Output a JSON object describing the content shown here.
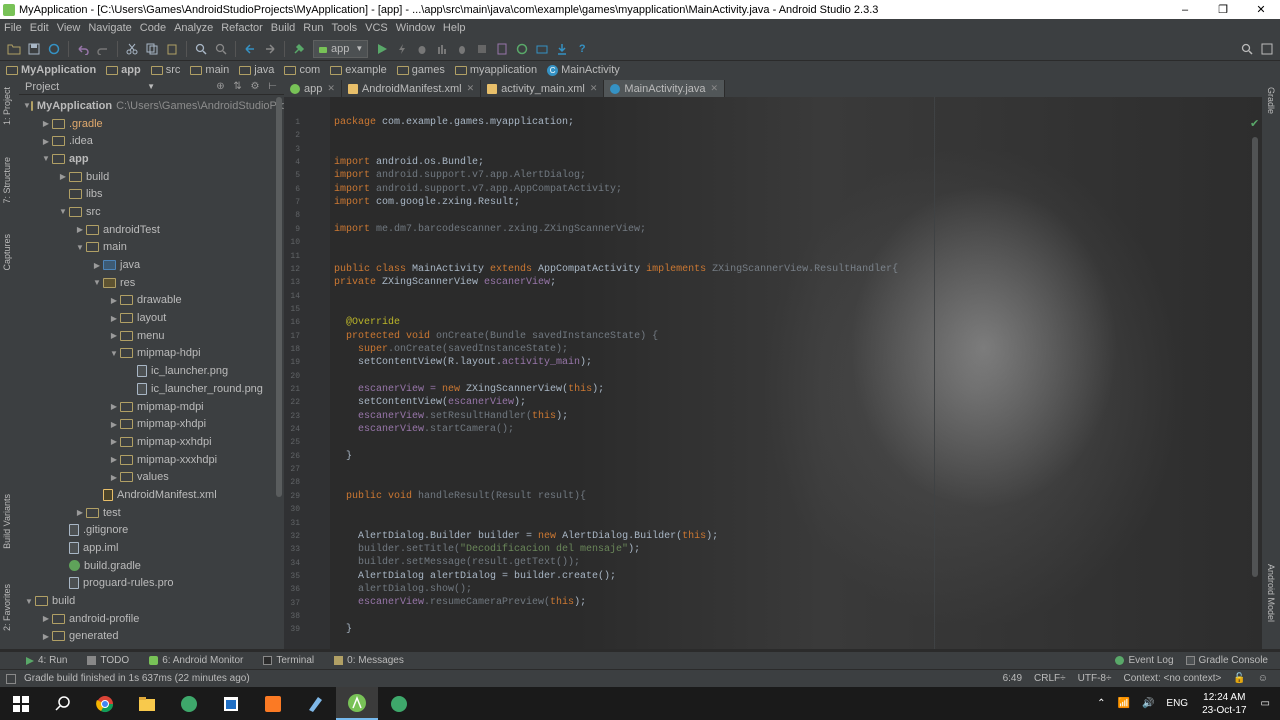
{
  "window": {
    "title": "MyApplication - [C:\\Users\\Games\\AndroidStudioProjects\\MyApplication] - [app] - ...\\app\\src\\main\\java\\com\\example\\games\\myapplication\\MainActivity.java - Android Studio 2.3.3",
    "minimize": "‒",
    "restore": "❐",
    "close": "✕"
  },
  "menu": [
    "File",
    "Edit",
    "View",
    "Navigate",
    "Code",
    "Analyze",
    "Refactor",
    "Build",
    "Run",
    "Tools",
    "VCS",
    "Window",
    "Help"
  ],
  "toolbar": {
    "run_config": "app"
  },
  "breadcrumbs": [
    "MyApplication",
    "app",
    "src",
    "main",
    "java",
    "com",
    "example",
    "games",
    "myapplication",
    "MainActivity"
  ],
  "left_strip": {
    "project": "1: Project",
    "structure": "7: Structure",
    "captures": "Captures",
    "build_variants": "Build Variants",
    "favorites": "2: Favorites"
  },
  "right_strip": {
    "gradle": "Gradle",
    "android_model": "Android Model"
  },
  "project_panel": {
    "view_selector": "Project",
    "root_path": "C:\\Users\\Games\\AndroidStudioProjects\\MyApplication",
    "tree": [
      {
        "label": "MyApplication",
        "depth": 0,
        "arrow": "▼",
        "icon": "folder",
        "style": "bold"
      },
      {
        "label": ".gradle",
        "depth": 1,
        "arrow": "▶",
        "icon": "folder",
        "style": "orange"
      },
      {
        "label": ".idea",
        "depth": 1,
        "arrow": "▶",
        "icon": "folder",
        "style": ""
      },
      {
        "label": "app",
        "depth": 1,
        "arrow": "▼",
        "icon": "folder",
        "style": "bold"
      },
      {
        "label": "build",
        "depth": 2,
        "arrow": "▶",
        "icon": "folder",
        "style": ""
      },
      {
        "label": "libs",
        "depth": 2,
        "arrow": "",
        "icon": "folder",
        "style": ""
      },
      {
        "label": "src",
        "depth": 2,
        "arrow": "▼",
        "icon": "folder",
        "style": ""
      },
      {
        "label": "androidTest",
        "depth": 3,
        "arrow": "▶",
        "icon": "folder",
        "style": ""
      },
      {
        "label": "main",
        "depth": 3,
        "arrow": "▼",
        "icon": "folder",
        "style": ""
      },
      {
        "label": "java",
        "depth": 4,
        "arrow": "▶",
        "icon": "blue",
        "style": ""
      },
      {
        "label": "res",
        "depth": 4,
        "arrow": "▼",
        "icon": "res",
        "style": ""
      },
      {
        "label": "drawable",
        "depth": 5,
        "arrow": "▶",
        "icon": "folder",
        "style": ""
      },
      {
        "label": "layout",
        "depth": 5,
        "arrow": "▶",
        "icon": "folder",
        "style": ""
      },
      {
        "label": "menu",
        "depth": 5,
        "arrow": "▶",
        "icon": "folder",
        "style": ""
      },
      {
        "label": "mipmap-hdpi",
        "depth": 5,
        "arrow": "▼",
        "icon": "folder",
        "style": ""
      },
      {
        "label": "ic_launcher.png",
        "depth": 6,
        "arrow": "",
        "icon": "file",
        "style": ""
      },
      {
        "label": "ic_launcher_round.png",
        "depth": 6,
        "arrow": "",
        "icon": "file",
        "style": ""
      },
      {
        "label": "mipmap-mdpi",
        "depth": 5,
        "arrow": "▶",
        "icon": "folder",
        "style": ""
      },
      {
        "label": "mipmap-xhdpi",
        "depth": 5,
        "arrow": "▶",
        "icon": "folder",
        "style": ""
      },
      {
        "label": "mipmap-xxhdpi",
        "depth": 5,
        "arrow": "▶",
        "icon": "folder",
        "style": ""
      },
      {
        "label": "mipmap-xxxhdpi",
        "depth": 5,
        "arrow": "▶",
        "icon": "folder",
        "style": ""
      },
      {
        "label": "values",
        "depth": 5,
        "arrow": "▶",
        "icon": "folder",
        "style": ""
      },
      {
        "label": "AndroidManifest.xml",
        "depth": 4,
        "arrow": "",
        "icon": "xml",
        "style": ""
      },
      {
        "label": "test",
        "depth": 3,
        "arrow": "▶",
        "icon": "folder",
        "style": ""
      },
      {
        "label": ".gitignore",
        "depth": 2,
        "arrow": "",
        "icon": "file",
        "style": ""
      },
      {
        "label": "app.iml",
        "depth": 2,
        "arrow": "",
        "icon": "file",
        "style": ""
      },
      {
        "label": "build.gradle",
        "depth": 2,
        "arrow": "",
        "icon": "gradle",
        "style": ""
      },
      {
        "label": "proguard-rules.pro",
        "depth": 2,
        "arrow": "",
        "icon": "file",
        "style": ""
      },
      {
        "label": "build",
        "depth": 0,
        "arrow": "▼",
        "icon": "folder",
        "style": ""
      },
      {
        "label": "android-profile",
        "depth": 1,
        "arrow": "▶",
        "icon": "folder",
        "style": ""
      },
      {
        "label": "generated",
        "depth": 1,
        "arrow": "▶",
        "icon": "folder",
        "style": ""
      }
    ]
  },
  "editor_tabs": [
    {
      "label": "app",
      "icon_color": "#78c257",
      "active": false
    },
    {
      "label": "AndroidManifest.xml",
      "icon_color": "#e8bf6a",
      "active": false
    },
    {
      "label": "activity_main.xml",
      "icon_color": "#e8bf6a",
      "active": false
    },
    {
      "label": "MainActivity.java",
      "icon_color": "#3592c4",
      "active": true
    }
  ],
  "editor": {
    "line_numbers": [
      "1",
      "2",
      "3",
      "4",
      "5",
      "6",
      "7",
      "8",
      "9",
      "10",
      "11",
      "12",
      "13",
      "14",
      "15",
      "16",
      "17",
      "18",
      "19",
      "20",
      "21",
      "22",
      "23",
      "24",
      "25",
      "26",
      "27",
      "28",
      "29",
      "30",
      "31",
      "32",
      "33",
      "34",
      "35",
      "36",
      "37",
      "38",
      "39"
    ],
    "lines": [
      [
        {
          "t": "package ",
          "c": "kw"
        },
        {
          "t": "com.example.games.myapplication;",
          "c": ""
        }
      ],
      [],
      [],
      [
        {
          "t": "import ",
          "c": "kw"
        },
        {
          "t": "android.os.Bundle;",
          "c": ""
        }
      ],
      [
        {
          "t": "import ",
          "c": "kw"
        },
        {
          "t": "android.support.v7.app.AlertDialog;",
          "c": "dim"
        }
      ],
      [
        {
          "t": "import ",
          "c": "kw"
        },
        {
          "t": "android.support.v7.app.AppCompatActivity;",
          "c": "dim"
        }
      ],
      [
        {
          "t": "import ",
          "c": "kw"
        },
        {
          "t": "com.google.zxing.Result;",
          "c": ""
        }
      ],
      [],
      [
        {
          "t": "import ",
          "c": "kw"
        },
        {
          "t": "me.dm7.barcodescanner.zxing.ZXingScannerView;",
          "c": "dim"
        }
      ],
      [],
      [],
      [
        {
          "t": "public class ",
          "c": "kw"
        },
        {
          "t": "MainActivity ",
          "c": ""
        },
        {
          "t": "extends ",
          "c": "kw"
        },
        {
          "t": "AppCompatActivity ",
          "c": ""
        },
        {
          "t": "implements ",
          "c": "kw"
        },
        {
          "t": "ZXingScannerView.ResultHandler{",
          "c": "dim"
        }
      ],
      [
        {
          "t": "private ",
          "c": "kw"
        },
        {
          "t": "ZXingScannerView ",
          "c": ""
        },
        {
          "t": "escanerView",
          "c": "fld"
        },
        {
          "t": ";",
          "c": ""
        }
      ],
      [],
      [],
      [
        {
          "t": "  @Override",
          "c": "ann"
        }
      ],
      [
        {
          "t": "  protected void ",
          "c": "kw"
        },
        {
          "t": "onCreate(Bundle savedInstanceState) {",
          "c": "dim"
        }
      ],
      [
        {
          "t": "    super",
          "c": "kw"
        },
        {
          "t": ".onCreate(savedInstanceState);",
          "c": "dim"
        }
      ],
      [
        {
          "t": "    setContentView(R.layout.",
          "c": ""
        },
        {
          "t": "activity_main",
          "c": "fld"
        },
        {
          "t": ");",
          "c": ""
        }
      ],
      [],
      [
        {
          "t": "    escanerView = ",
          "c": "fld"
        },
        {
          "t": "new ",
          "c": "kw"
        },
        {
          "t": "ZXingScannerView(",
          "c": ""
        },
        {
          "t": "this",
          "c": "kw"
        },
        {
          "t": ");",
          "c": ""
        }
      ],
      [
        {
          "t": "    setContentView(",
          "c": ""
        },
        {
          "t": "escanerView",
          "c": "fld"
        },
        {
          "t": ");",
          "c": ""
        }
      ],
      [
        {
          "t": "    escanerView",
          "c": "fld"
        },
        {
          "t": ".setResultHandler(",
          "c": "dim"
        },
        {
          "t": "this",
          "c": "kw"
        },
        {
          "t": ");",
          "c": ""
        }
      ],
      [
        {
          "t": "    escanerView",
          "c": "fld"
        },
        {
          "t": ".startCamera();",
          "c": "dim"
        }
      ],
      [],
      [
        {
          "t": "  }",
          "c": ""
        }
      ],
      [],
      [],
      [
        {
          "t": "  public void ",
          "c": "kw"
        },
        {
          "t": "handleResult(Result result){",
          "c": "dim"
        }
      ],
      [],
      [],
      [
        {
          "t": "    AlertDialog.Builder builder = ",
          "c": ""
        },
        {
          "t": "new ",
          "c": "kw"
        },
        {
          "t": "AlertDialog.Builder(",
          "c": ""
        },
        {
          "t": "this",
          "c": "kw"
        },
        {
          "t": ");",
          "c": ""
        }
      ],
      [
        {
          "t": "    builder.setTitle(",
          "c": "dim"
        },
        {
          "t": "\"Decodificacion del mensaje\"",
          "c": "str"
        },
        {
          "t": ");",
          "c": ""
        }
      ],
      [
        {
          "t": "    builder.setMessage(result.getText());",
          "c": "dim"
        }
      ],
      [
        {
          "t": "    AlertDialog alertDialog = builder.create();",
          "c": ""
        }
      ],
      [
        {
          "t": "    alertDialog.show();",
          "c": "dim"
        }
      ],
      [
        {
          "t": "    escanerView",
          "c": "fld"
        },
        {
          "t": ".resumeCameraPreview(",
          "c": "dim"
        },
        {
          "t": "this",
          "c": "kw"
        },
        {
          "t": ");",
          "c": ""
        }
      ],
      [],
      [
        {
          "t": "  }",
          "c": ""
        }
      ],
      [],
      [
        {
          "t": "}",
          "c": ""
        }
      ]
    ]
  },
  "bottom_tabs": {
    "run": "4: Run",
    "todo": "TODO",
    "monitor": "6: Android Monitor",
    "terminal": "Terminal",
    "messages": "0: Messages",
    "event_log": "Event Log",
    "gradle_console": "Gradle Console"
  },
  "status": {
    "message": "Gradle build finished in 1s 637ms (22 minutes ago)",
    "position": "6:49",
    "line_sep": "CRLF÷",
    "encoding": "UTF-8÷",
    "context": "Context: <no context>"
  },
  "taskbar": {
    "lang": "ENG",
    "time": "12:24 AM",
    "date": "23-Oct-17"
  },
  "colors": {
    "accent": "#3592c4",
    "keyword": "#cc7832",
    "string": "#6a8759",
    "field": "#9876aa",
    "annotation": "#bbb529",
    "run_green": "#59a869"
  }
}
